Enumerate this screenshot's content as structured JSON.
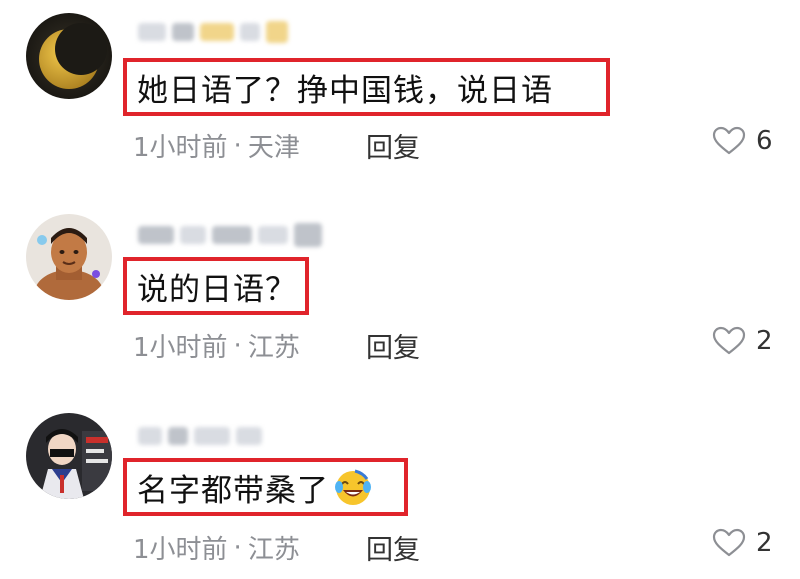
{
  "comments": [
    {
      "text": "她日语了？挣中国钱，说日语",
      "time": "1小时前",
      "separator": "·",
      "location": "天津",
      "reply_label": "回复",
      "likes": "6"
    },
    {
      "text": "说的日语？",
      "time": "1小时前",
      "separator": "·",
      "location": "江苏",
      "reply_label": "回复",
      "likes": "2"
    },
    {
      "text": "名字都带桑了",
      "emoji": "laughing-crying-emoji",
      "time": "1小时前",
      "separator": "·",
      "location": "江苏",
      "reply_label": "回复",
      "likes": "2"
    }
  ],
  "colors": {
    "highlight_border": "#e0242b",
    "meta_text": "#8d8f94",
    "background": "#ffffff"
  },
  "icons": {
    "like": "heart-outline-icon"
  }
}
